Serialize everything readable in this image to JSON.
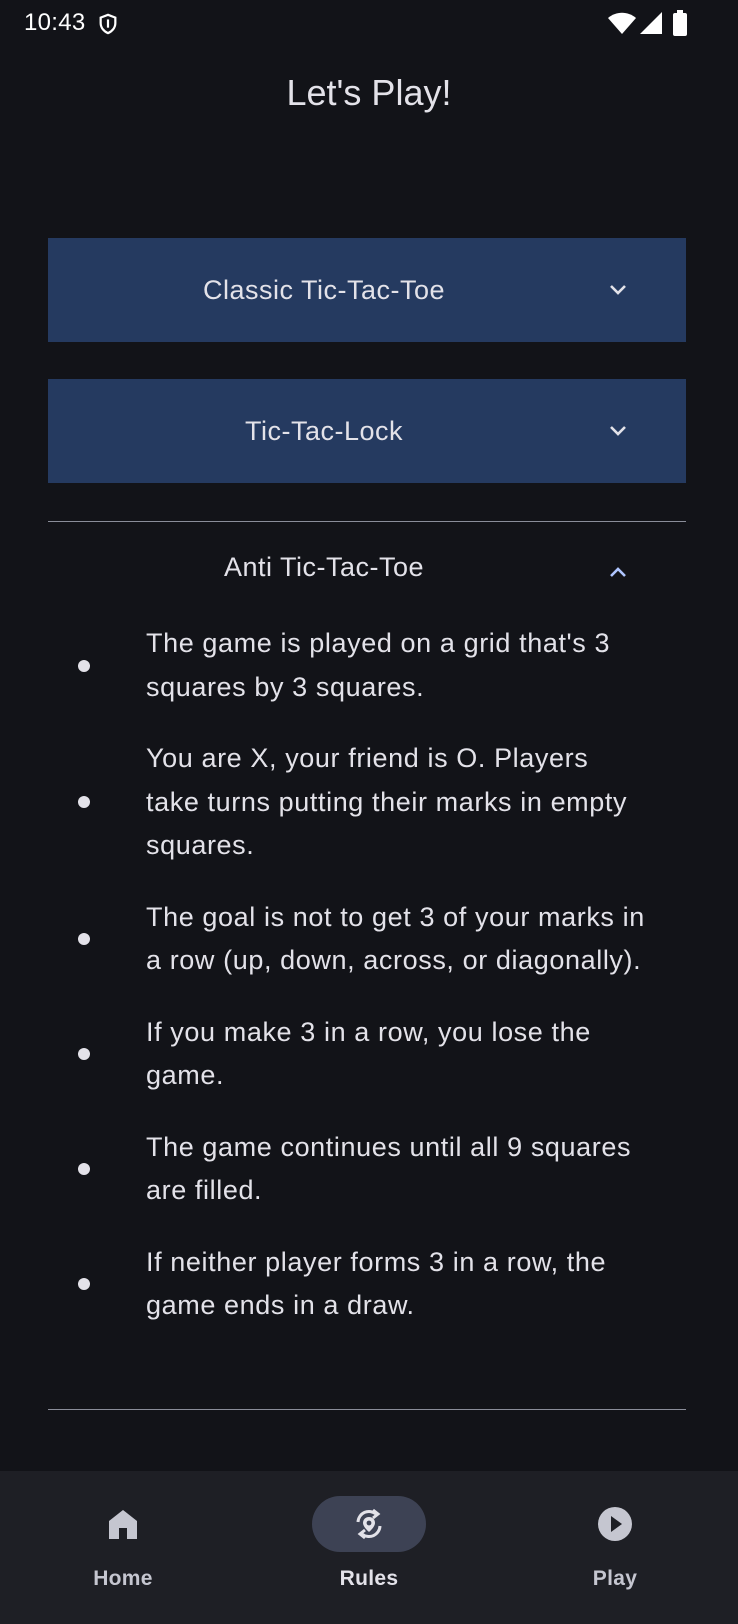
{
  "status_bar": {
    "time": "10:43",
    "icons": [
      "shield-icon",
      "wifi-icon",
      "signal-icon",
      "battery-icon"
    ]
  },
  "page": {
    "title": "Let's Play!"
  },
  "colors": {
    "background": "#121318",
    "panel": "#253a60",
    "accent": "#b0c6ff",
    "nav_background": "#1e1f25",
    "nav_active_pill": "#3d4254"
  },
  "game_modes": [
    {
      "label": "Classic Tic-Tac-Toe",
      "expanded": false,
      "icon": "chevron-down-icon"
    },
    {
      "label": "Tic-Tac-Lock",
      "expanded": false,
      "icon": "chevron-down-icon"
    },
    {
      "label": "Anti Tic-Tac-Toe",
      "expanded": true,
      "icon": "chevron-up-icon"
    }
  ],
  "anti_rules": [
    "The game is played on a grid that's 3 squares by 3 squares.",
    "You are X, your friend is O. Players take turns putting their marks in empty squares.",
    "The goal is not to get 3 of your marks in a row (up, down, across, or diagonally).",
    "If you make 3 in a row, you lose the game.",
    "The game continues until all 9 squares are filled.",
    "If neither player forms 3 in a row, the game ends in a draw."
  ],
  "bottom_nav": {
    "items": [
      {
        "label": "Home",
        "icon": "home-icon",
        "active": false
      },
      {
        "label": "Rules",
        "icon": "rules-icon",
        "active": true
      },
      {
        "label": "Play",
        "icon": "play-icon",
        "active": false
      }
    ]
  }
}
